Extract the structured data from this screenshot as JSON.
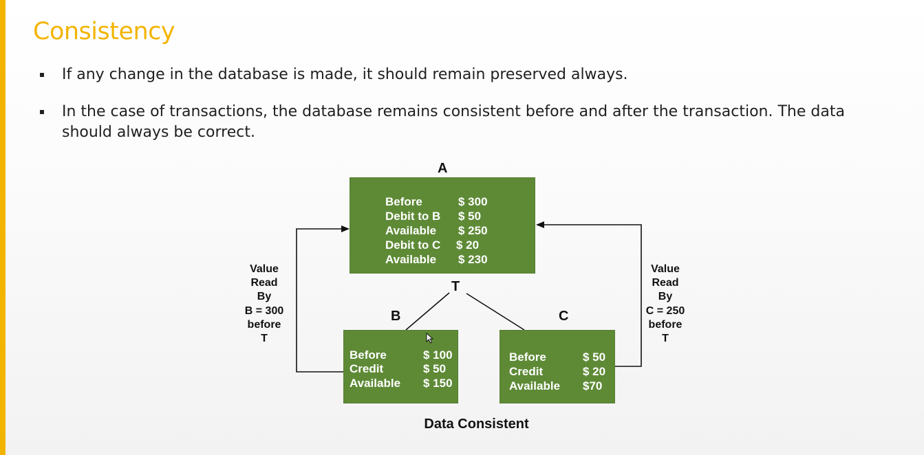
{
  "slide": {
    "title": "Consistency",
    "bullets": [
      "If any change in the database is made, it should remain preserved always.",
      "In the case of transactions, the database remains consistent before and after the transaction. The data should always be correct."
    ],
    "accent_color": "#f3b400"
  },
  "diagram": {
    "node_a": {
      "label": "A",
      "rows": [
        {
          "label": "Before",
          "value": "$ 300"
        },
        {
          "label": "Debit to B",
          "value": "$ 50"
        },
        {
          "label": "Available",
          "value": "$ 250"
        },
        {
          "label": "Debit to C",
          "value": "$ 20"
        },
        {
          "label": "Available",
          "value": "$ 230"
        }
      ]
    },
    "node_b": {
      "label": "B",
      "rows": [
        {
          "label": "Before",
          "value": "$ 100"
        },
        {
          "label": "Credit",
          "value": "$ 50"
        },
        {
          "label": "Available",
          "value": "$ 150"
        }
      ]
    },
    "node_c": {
      "label": "C",
      "rows": [
        {
          "label": "Before",
          "value": "$ 50"
        },
        {
          "label": "Credit",
          "value": "$ 20"
        },
        {
          "label": "Available",
          "value": "$70"
        }
      ]
    },
    "transaction_label": "T",
    "left_note": [
      "Value",
      "Read",
      "By",
      "B = 300",
      "before",
      "T"
    ],
    "right_note": [
      "Value",
      "Read",
      "By",
      "C = 250",
      "before",
      "T"
    ],
    "caption": "Data Consistent",
    "box_color": "#5e8a36"
  }
}
